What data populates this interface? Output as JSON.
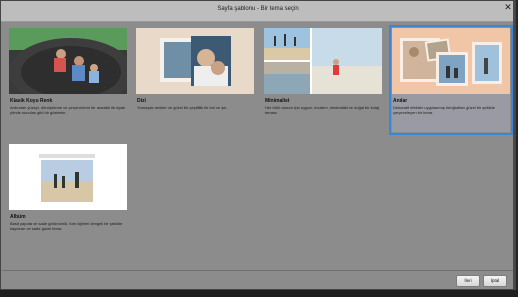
{
  "dialog": {
    "title": "Sayfa şablonu - Bir tema seçin",
    "close_icon": "close-icon"
  },
  "themes": [
    {
      "name": "Klasik Koyu Renk",
      "description": "Ardından yüzeyi, dönüştürme ve çerçevelerin bir aradaki ile siyah yönde sunulan gibi bir gösterim.",
      "selected": false
    },
    {
      "name": "Dizi",
      "description": "Yumuşak renkler ve güzel bir çeşitlilik ile bol ve şık.",
      "selected": false
    },
    {
      "name": "Minimalist",
      "description": "Her türlü durum için uygun, modern, minimalist ve doğal bir kolaj teması",
      "selected": false
    },
    {
      "name": "Anılar",
      "description": "Dekoratif efektler uygulanmış fotoğrafları güzel bir şekilde çerçeveleyen bir tema.",
      "selected": true
    },
    {
      "name": "Albüm",
      "description": "Basit yapıda ve sade görünümlü, tüm öğeleri dengeli bir şekilde kaydıran ve sade güzel tema.",
      "selected": false
    }
  ],
  "footer": {
    "ok_label": "İleri",
    "cancel_label": "İptal"
  },
  "colors": {
    "selection": "#3c86d6",
    "panel": "#8c8c8c"
  }
}
